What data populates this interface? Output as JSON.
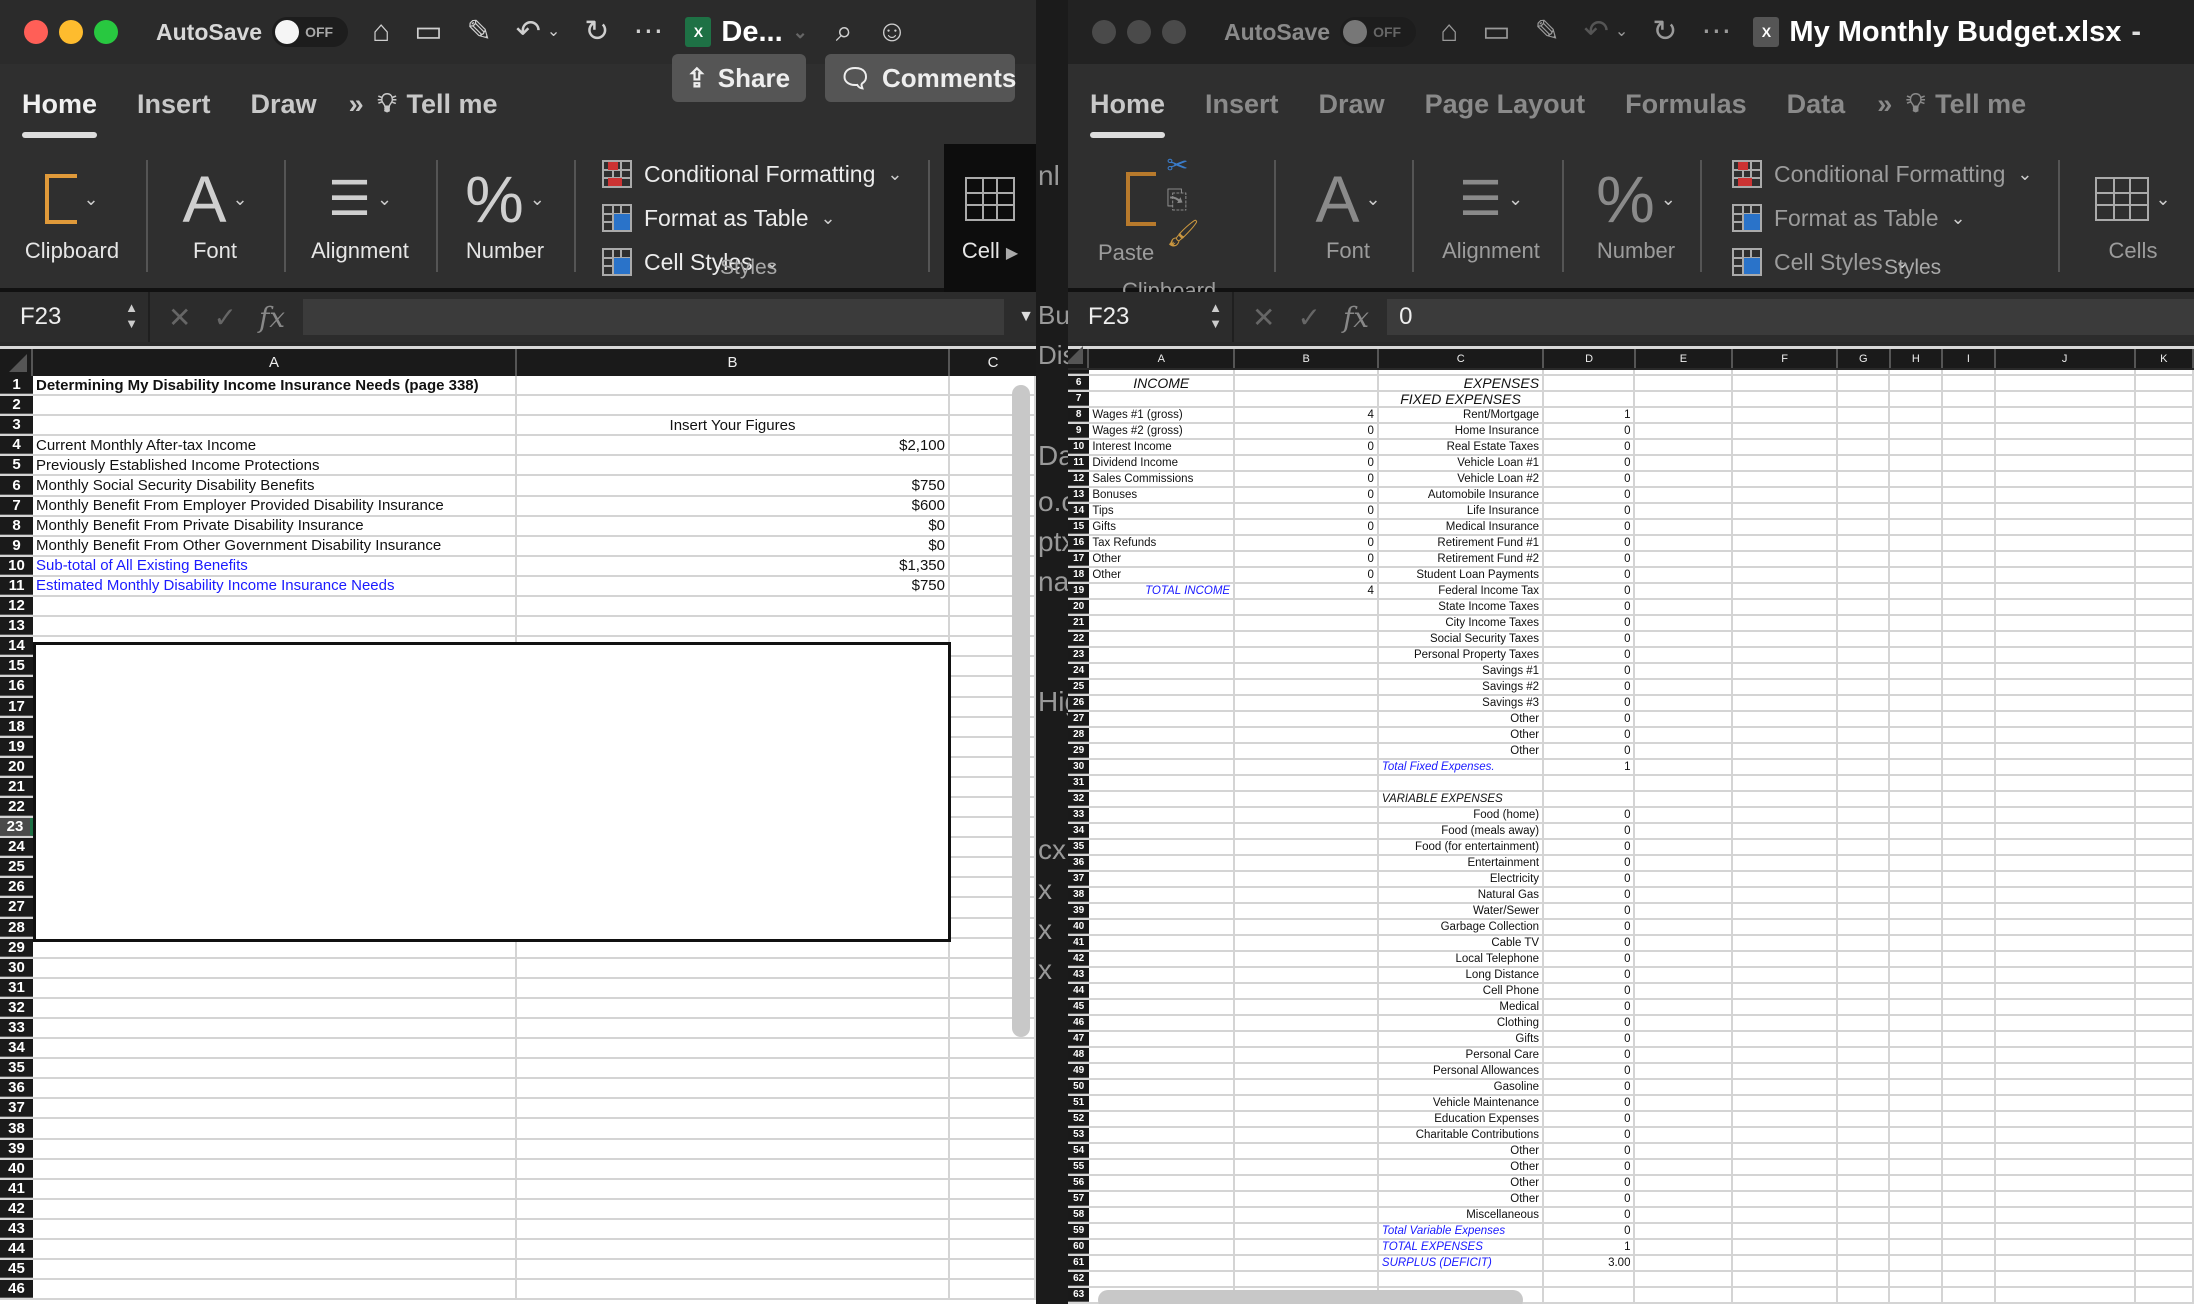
{
  "left_window": {
    "autosave_label": "AutoSave",
    "autosave_state": "OFF",
    "doc_title": "De...",
    "tabs": [
      "Home",
      "Insert",
      "Draw",
      "Tell me"
    ],
    "overflow": "»",
    "share_label": "Share",
    "comments_label": "Comments",
    "ribbon": {
      "clipboard": "Clipboard",
      "font": "Font",
      "alignment": "Alignment",
      "number": "Number",
      "conditional_formatting": "Conditional Formatting",
      "format_as_table": "Format as Table",
      "cell_styles": "Cell Styles",
      "styles_group": "Styles",
      "cells": "Cell"
    },
    "name_box": "F23",
    "formula_value": "",
    "columns": [
      "A",
      "B",
      "C"
    ],
    "rows": [
      {
        "n": "1",
        "a": "Determining My Disability Income Insurance Needs (page 338)",
        "b": "",
        "style": "bold"
      },
      {
        "n": "2",
        "a": "",
        "b": ""
      },
      {
        "n": "3",
        "a": "",
        "b": "Insert Your Figures",
        "b_align": "center"
      },
      {
        "n": "4",
        "a": "Current Monthly After-tax Income",
        "b": "$2,100"
      },
      {
        "n": "5",
        "a": "Previously Established Income Protections",
        "b": ""
      },
      {
        "n": "6",
        "a": "Monthly Social Security Disability Benefits",
        "b": "$750"
      },
      {
        "n": "7",
        "a": "Monthly Benefit From Employer Provided Disability Insurance",
        "b": "$600"
      },
      {
        "n": "8",
        "a": "Monthly Benefit From Private Disability Insurance",
        "b": "$0"
      },
      {
        "n": "9",
        "a": "Monthly Benefit From Other Government Disability Insurance",
        "b": "$0"
      },
      {
        "n": "10",
        "a": "Sub-total of All Existing Benefits",
        "b": "$1,350",
        "style": "blue"
      },
      {
        "n": "11",
        "a": "Estimated Monthly Disability Income Insurance Needs",
        "b": "$750",
        "style": "blue"
      }
    ],
    "row_count": 46,
    "selected_row": 23
  },
  "middle_strip": {
    "fragments": [
      "nl",
      "Bud",
      "Dis",
      "Day",
      "o.c",
      "ptx",
      "na",
      "Hig",
      "cx",
      "x",
      "x",
      "x"
    ]
  },
  "right_window": {
    "autosave_label": "AutoSave",
    "autosave_state": "OFF",
    "doc_title": "My Monthly Budget.xlsx",
    "tabs": [
      "Home",
      "Insert",
      "Draw",
      "Page Layout",
      "Formulas",
      "Data",
      "Tell me"
    ],
    "overflow": "»",
    "ribbon": {
      "paste": "Paste",
      "clipboard": "Clipboard",
      "font": "Font",
      "alignment": "Alignment",
      "number": "Number",
      "conditional_formatting": "Conditional Formatting",
      "format_as_table": "Format as Table",
      "cell_styles": "Cell Styles",
      "styles_group": "Styles",
      "cells": "Cells"
    },
    "name_box": "F23",
    "formula_value": "0",
    "columns": [
      "A",
      "B",
      "C",
      "D",
      "E",
      "F",
      "G",
      "H",
      "I",
      "J",
      "K"
    ],
    "rows": [
      {
        "n": "6",
        "a": "INCOME",
        "b": "",
        "c": "EXPENSES",
        "d": "",
        "a_style": "it-center",
        "c_style": "it-right-big"
      },
      {
        "n": "7",
        "a": "",
        "b": "",
        "c": "FIXED EXPENSES",
        "d": "",
        "c_style": "it-center-big"
      },
      {
        "n": "8",
        "a": "Wages #1 (gross)",
        "b": "4",
        "c": "Rent/Mortgage",
        "d": "1"
      },
      {
        "n": "9",
        "a": "Wages #2 (gross)",
        "b": "0",
        "c": "Home Insurance",
        "d": "0"
      },
      {
        "n": "10",
        "a": "Interest Income",
        "b": "0",
        "c": "Real Estate Taxes",
        "d": "0"
      },
      {
        "n": "11",
        "a": "Dividend Income",
        "b": "0",
        "c": "Vehicle Loan #1",
        "d": "0"
      },
      {
        "n": "12",
        "a": "Sales Commissions",
        "b": "0",
        "c": "Vehicle Loan #2",
        "d": "0"
      },
      {
        "n": "13",
        "a": "Bonuses",
        "b": "0",
        "c": "Automobile Insurance",
        "d": "0"
      },
      {
        "n": "14",
        "a": "Tips",
        "b": "0",
        "c": "Life Insurance",
        "d": "0"
      },
      {
        "n": "15",
        "a": "Gifts",
        "b": "0",
        "c": "Medical Insurance",
        "d": "0"
      },
      {
        "n": "16",
        "a": "Tax Refunds",
        "b": "0",
        "c": "Retirement Fund #1",
        "d": "0"
      },
      {
        "n": "17",
        "a": "Other",
        "b": "0",
        "c": "Retirement Fund #2",
        "d": "0"
      },
      {
        "n": "18",
        "a": "Other",
        "b": "0",
        "c": "Student Loan Payments",
        "d": "0"
      },
      {
        "n": "19",
        "a": "TOTAL INCOME",
        "b": "4",
        "c": "Federal Income Tax",
        "d": "0",
        "a_style": "blue-it-right"
      },
      {
        "n": "20",
        "a": "",
        "b": "",
        "c": "State Income Taxes",
        "d": "0"
      },
      {
        "n": "21",
        "a": "",
        "b": "",
        "c": "City Income Taxes",
        "d": "0"
      },
      {
        "n": "22",
        "a": "",
        "b": "",
        "c": "Social Security Taxes",
        "d": "0"
      },
      {
        "n": "23",
        "a": "",
        "b": "",
        "c": "Personal Property Taxes",
        "d": "0"
      },
      {
        "n": "24",
        "a": "",
        "b": "",
        "c": "Savings #1",
        "d": "0"
      },
      {
        "n": "25",
        "a": "",
        "b": "",
        "c": "Savings #2",
        "d": "0"
      },
      {
        "n": "26",
        "a": "",
        "b": "",
        "c": "Savings #3",
        "d": "0"
      },
      {
        "n": "27",
        "a": "",
        "b": "",
        "c": "Other",
        "d": "0"
      },
      {
        "n": "28",
        "a": "",
        "b": "",
        "c": "Other",
        "d": "0"
      },
      {
        "n": "29",
        "a": "",
        "b": "",
        "c": "Other",
        "d": "0"
      },
      {
        "n": "30",
        "a": "",
        "b": "",
        "c": "Total Fixed Expenses.",
        "d": "1",
        "c_style": "blue-it-left"
      },
      {
        "n": "31",
        "a": "",
        "b": "",
        "c": "",
        "d": ""
      },
      {
        "n": "32",
        "a": "",
        "b": "",
        "c": "VARIABLE EXPENSES",
        "d": "",
        "c_style": "it-left"
      },
      {
        "n": "33",
        "a": "",
        "b": "",
        "c": "Food (home)",
        "d": "0"
      },
      {
        "n": "34",
        "a": "",
        "b": "",
        "c": "Food (meals away)",
        "d": "0"
      },
      {
        "n": "35",
        "a": "",
        "b": "",
        "c": "Food (for entertainment)",
        "d": "0"
      },
      {
        "n": "36",
        "a": "",
        "b": "",
        "c": "Entertainment",
        "d": "0"
      },
      {
        "n": "37",
        "a": "",
        "b": "",
        "c": "Electricity",
        "d": "0"
      },
      {
        "n": "38",
        "a": "",
        "b": "",
        "c": "Natural Gas",
        "d": "0"
      },
      {
        "n": "39",
        "a": "",
        "b": "",
        "c": "Water/Sewer",
        "d": "0"
      },
      {
        "n": "40",
        "a": "",
        "b": "",
        "c": "Garbage Collection",
        "d": "0"
      },
      {
        "n": "41",
        "a": "",
        "b": "",
        "c": "Cable TV",
        "d": "0"
      },
      {
        "n": "42",
        "a": "",
        "b": "",
        "c": "Local Telephone",
        "d": "0"
      },
      {
        "n": "43",
        "a": "",
        "b": "",
        "c": "Long  Distance",
        "d": "0"
      },
      {
        "n": "44",
        "a": "",
        "b": "",
        "c": "Cell Phone",
        "d": "0"
      },
      {
        "n": "45",
        "a": "",
        "b": "",
        "c": "Medical ",
        "d": "0"
      },
      {
        "n": "46",
        "a": "",
        "b": "",
        "c": "Clothing",
        "d": "0"
      },
      {
        "n": "47",
        "a": "",
        "b": "",
        "c": "Gifts",
        "d": "0"
      },
      {
        "n": "48",
        "a": "",
        "b": "",
        "c": "Personal Care",
        "d": "0"
      },
      {
        "n": "49",
        "a": "",
        "b": "",
        "c": "Personal Allowances",
        "d": "0"
      },
      {
        "n": "50",
        "a": "",
        "b": "",
        "c": "Gasoline",
        "d": "0"
      },
      {
        "n": "51",
        "a": "",
        "b": "",
        "c": "Vehicle Maintenance",
        "d": "0"
      },
      {
        "n": "52",
        "a": "",
        "b": "",
        "c": "Education Expenses",
        "d": "0"
      },
      {
        "n": "53",
        "a": "",
        "b": "",
        "c": "Charitable Contributions",
        "d": "0"
      },
      {
        "n": "54",
        "a": "",
        "b": "",
        "c": "Other",
        "d": "0"
      },
      {
        "n": "55",
        "a": "",
        "b": "",
        "c": "Other",
        "d": "0"
      },
      {
        "n": "56",
        "a": "",
        "b": "",
        "c": "Other",
        "d": "0"
      },
      {
        "n": "57",
        "a": "",
        "b": "",
        "c": "Other",
        "d": "0"
      },
      {
        "n": "58",
        "a": "",
        "b": "",
        "c": "Miscellaneous",
        "d": "0"
      },
      {
        "n": "59",
        "a": "",
        "b": "",
        "c": "Total Variable Expenses",
        "d": "0",
        "c_style": "blue-it-left"
      },
      {
        "n": "60",
        "a": "",
        "b": "",
        "c": "TOTAL EXPENSES",
        "d": "1",
        "c_style": "blue-it-left"
      },
      {
        "n": "61",
        "a": "",
        "b": "",
        "c": "SURPLUS (DEFICIT)",
        "d": "3.00",
        "c_style": "blue-it-left"
      },
      {
        "n": "62",
        "a": "",
        "b": "",
        "c": "",
        "d": ""
      },
      {
        "n": "63",
        "a": "",
        "b": "",
        "c": "",
        "d": ""
      }
    ]
  }
}
